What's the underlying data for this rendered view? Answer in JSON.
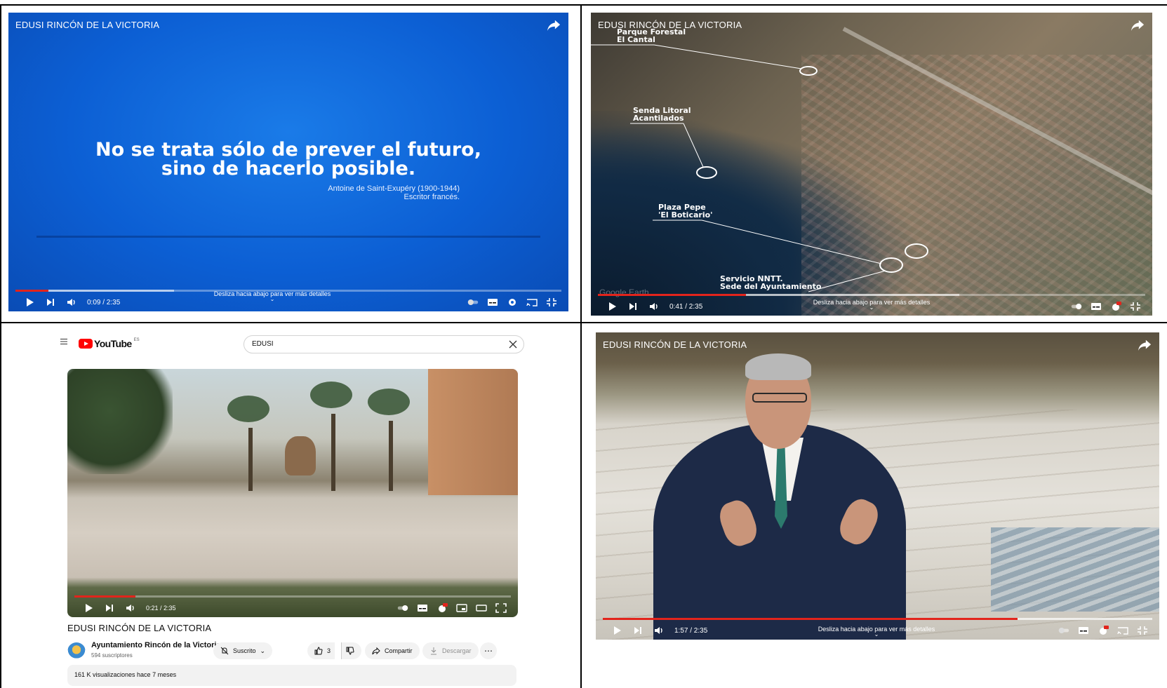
{
  "player_common": {
    "title": "EDUSI RINCÓN DE LA VICTORIA",
    "hint": "Desliza hacia abajo para ver más detalles",
    "hint_icon": "chevron-down-icon",
    "accent": "#e2241c"
  },
  "panel1": {
    "quote_line1": "No se trata sólo de prever el futuro,",
    "quote_line2": "sino de hacerlo posible.",
    "author_line1": "Antoine de Saint-Exupéry (1900-1944)",
    "author_line2": "Escritor francés.",
    "time": "0:09 / 2:35",
    "progress": 0.06,
    "buffered": 0.29,
    "background": "#0c5fd4"
  },
  "panel2": {
    "labels": {
      "parque_1": "Parque Forestal",
      "parque_2": "El Cantal",
      "senda_1": "Senda Litoral",
      "senda_2": "Acantilados",
      "plaza_1": "Plaza Pepe",
      "plaza_2": "'El Boticario'",
      "servicio_1": "Servicio NNTT.",
      "servicio_2": "Sede del Ayuntamiento"
    },
    "watermark": "Google Earth",
    "time": "0:41 / 2:35",
    "progress": 0.27,
    "buffered": 0.66
  },
  "panel3": {
    "logo_text": "YouTube",
    "logo_country": "ES",
    "search_value": "EDUSI",
    "time": "0:21 / 2:35",
    "progress": 0.14,
    "buffered": 0.14,
    "video_title": "EDUSI RINCÓN DE LA VICTORIA",
    "channel_name": "Ayuntamiento Rincón de la Victoria",
    "subscribers": "594 suscriptores",
    "subscribed_label": "Suscrito",
    "likes": "3",
    "share_label": "Compartir",
    "download_label": "Descargar",
    "stats": "161 K visualizaciones  hace 7 meses"
  },
  "panel4": {
    "time": "1:57 / 2:35",
    "progress": 0.755,
    "buffered": 1.0
  }
}
